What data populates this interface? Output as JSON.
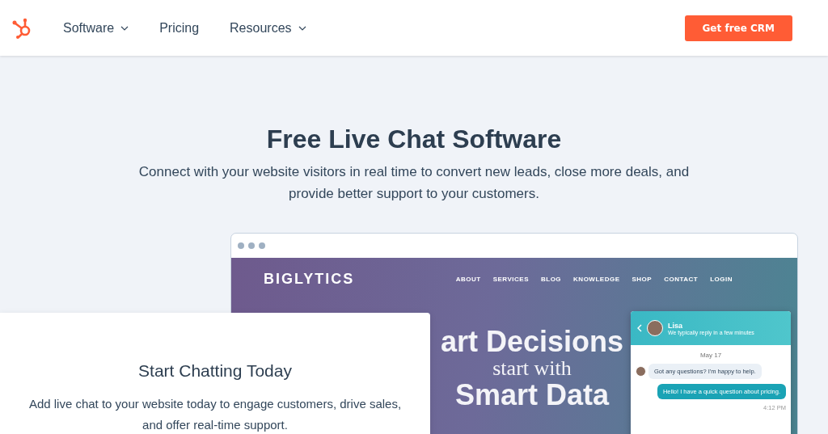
{
  "header": {
    "nav": [
      {
        "label": "Software",
        "dropdown": true
      },
      {
        "label": "Pricing",
        "dropdown": false
      },
      {
        "label": "Resources",
        "dropdown": true
      }
    ],
    "cta": "Get free CRM"
  },
  "hero": {
    "title": "Free Live Chat Software",
    "subtitle": "Connect with your website visitors in real time to convert new leads, close more deals, and provide better support to your customers."
  },
  "mockup": {
    "brand": "BIGLYTICS",
    "nav": [
      "ABOUT",
      "SERVICES",
      "BLOG",
      "KNOWLEDGE",
      "SHOP",
      "CONTACT",
      "LOGIN"
    ],
    "headline": [
      "art Decisions",
      "start with",
      "Smart Data"
    ],
    "chat": {
      "agent": "Lisa",
      "status": "We typically reply in a few minutes",
      "date": "May 17",
      "messages": [
        {
          "text": "Got any questions? I'm happy to help.",
          "kind": "received"
        },
        {
          "text": "Hello! I have a quick question about pricing.",
          "kind": "sent"
        }
      ],
      "time": "4:12 PM"
    }
  },
  "card": {
    "title": "Start Chatting Today",
    "body": "Add live chat to your website today to engage customers, drive sales, and offer real-time support."
  }
}
